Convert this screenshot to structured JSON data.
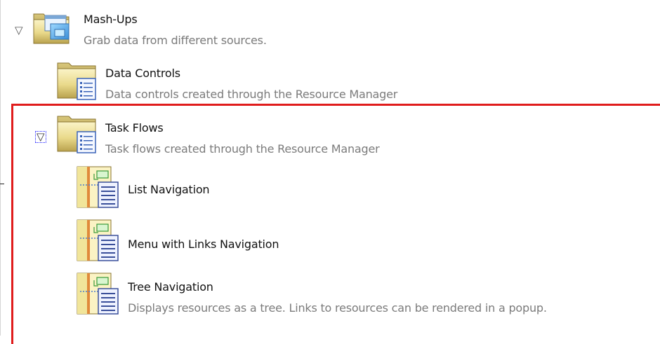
{
  "tree": {
    "mashups": {
      "toggle": "▽",
      "title": "Mash-Ups",
      "description": "Grab data from different sources.",
      "icon": "mashup-folder-icon"
    },
    "data_controls": {
      "title": "Data Controls",
      "description": "Data controls created through the Resource Manager",
      "icon": "folder-list-icon"
    },
    "task_flows": {
      "toggle": "▽",
      "title": "Task Flows",
      "description": "Task flows created through the Resource Manager",
      "icon": "folder-list-icon",
      "items": [
        {
          "title": "List Navigation",
          "description": "",
          "icon": "task-flow-icon"
        },
        {
          "title": "Menu with Links Navigation",
          "description": "",
          "icon": "task-flow-icon"
        },
        {
          "title": "Tree Navigation",
          "description": "Displays resources as a tree. Links to resources can be rendered in a popup.",
          "icon": "task-flow-icon"
        }
      ]
    }
  },
  "colors": {
    "highlight_border": "#e01c1c",
    "description_text": "#7b7b7b",
    "focus_outline": "#1a1aff"
  }
}
